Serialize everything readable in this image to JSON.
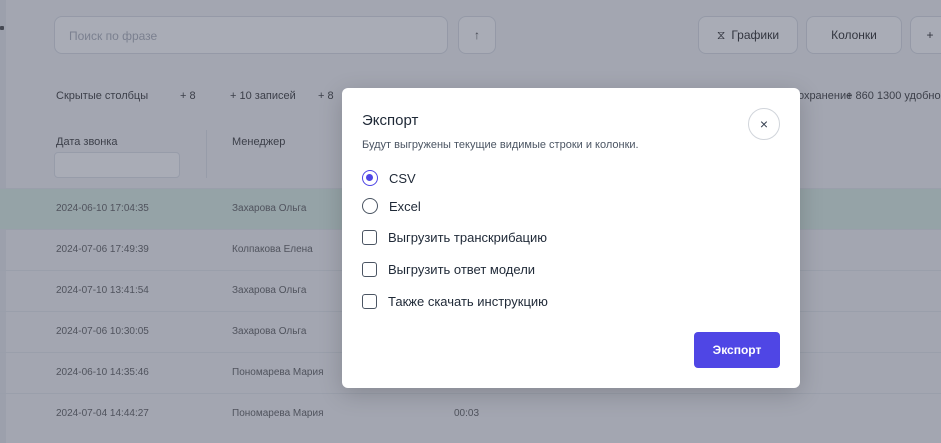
{
  "background": {
    "search_placeholder": "Поиск по фразе",
    "search_btn": "↑",
    "toolbar": [
      "Графики",
      "Колонки"
    ],
    "toolbar_add": "+",
    "subbar": [
      "Скрытые столбцы",
      "+ 8",
      "+ 10 записей",
      "+ 8"
    ],
    "subbar_right": [
      "Сохранение",
      "+ 860 1300 удобно"
    ],
    "columns": [
      "Дата звонка",
      "Менеджер"
    ],
    "rows": [
      {
        "date": "2024-06-10 17:04:35",
        "name": "Захарова Ольга",
        "extra": ""
      },
      {
        "date": "2024-07-06 17:49:39",
        "name": "Колпакова Елена",
        "extra": ""
      },
      {
        "date": "2024-07-10 13:41:54",
        "name": "Захарова Ольга",
        "extra": ""
      },
      {
        "date": "2024-07-06 10:30:05",
        "name": "Захарова Ольга",
        "extra": ""
      },
      {
        "date": "2024-06-10 14:35:46",
        "name": "Пономарева Мария",
        "extra": ""
      },
      {
        "date": "2024-07-04 14:44:27",
        "name": "Пономарева Мария",
        "extra": "00:03"
      }
    ]
  },
  "modal": {
    "title": "Экспорт",
    "description": "Будут выгружены текущие видимые строки и колонки.",
    "close_label": "×",
    "format_options": [
      {
        "label": "CSV",
        "selected": true
      },
      {
        "label": "Excel",
        "selected": false
      }
    ],
    "checkboxes": [
      {
        "label": "Выгрузить транскрибацию",
        "checked": false
      },
      {
        "label": "Выгрузить ответ модели",
        "checked": false
      },
      {
        "label": "Также скачать инструкцию",
        "checked": false
      }
    ],
    "submit_label": "Экспорт"
  },
  "colors": {
    "accent": "#4f46e5",
    "overlay": "rgba(50,58,80,0.42)"
  }
}
